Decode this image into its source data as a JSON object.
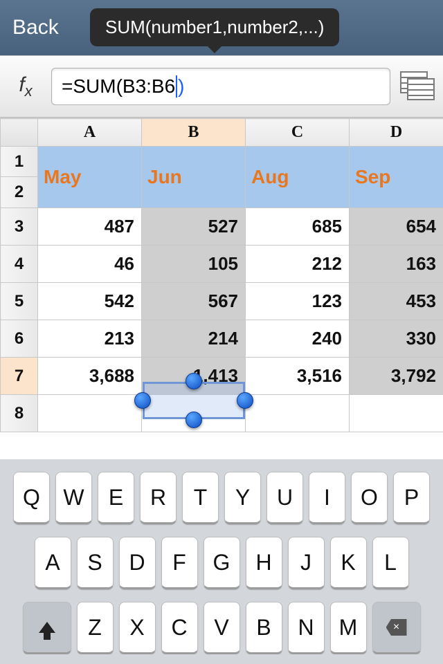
{
  "header": {
    "back_label": "Back",
    "tooltip": "SUM(number1,number2,...)"
  },
  "formula": {
    "fx_symbol": "f",
    "fx_sub": "x",
    "text_before": "=SUM(B3:B6",
    "text_after": ")"
  },
  "columns": [
    "A",
    "B",
    "C",
    "D"
  ],
  "row_numbers": [
    "1",
    "2",
    "3",
    "4",
    "5",
    "6",
    "7",
    "8"
  ],
  "months": [
    "May",
    "Jun",
    "Aug",
    "Sep"
  ],
  "data_rows": [
    [
      "487",
      "527",
      "685",
      "654"
    ],
    [
      "46",
      "105",
      "212",
      "163"
    ],
    [
      "542",
      "567",
      "123",
      "453"
    ],
    [
      "213",
      "214",
      "240",
      "330"
    ],
    [
      "3,688",
      "1,413",
      "3,516",
      "3,792"
    ]
  ],
  "keyboard": {
    "row1": [
      "Q",
      "W",
      "E",
      "R",
      "T",
      "Y",
      "U",
      "I",
      "O",
      "P"
    ],
    "row2": [
      "A",
      "S",
      "D",
      "F",
      "G",
      "H",
      "J",
      "K",
      "L"
    ],
    "row3": [
      "Z",
      "X",
      "C",
      "V",
      "B",
      "N",
      "M"
    ]
  }
}
